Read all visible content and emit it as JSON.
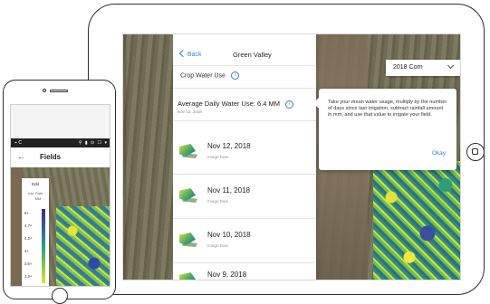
{
  "tablet": {
    "nav": {
      "back_label": "Back",
      "title": "Green Valley"
    },
    "section_title": "Crop Water Use",
    "average": {
      "label": "Average Daily Water Use: 6.4 MM",
      "date": "Nov 12, 2018"
    },
    "items": [
      {
        "date": "Nov 12, 2018",
        "subtitle": "Image Date"
      },
      {
        "date": "Nov 11, 2018",
        "subtitle": "Image Date"
      },
      {
        "date": "Nov 10, 2018",
        "subtitle": "Image Date"
      },
      {
        "date": "Nov 9, 2018",
        "subtitle": ""
      }
    ],
    "crop_select": {
      "value": "2018 Corn"
    },
    "tooltip": {
      "text": "Take your mean water usage, multiply by the number of days since last irrigation, subtract rainfall amount in mm, and use that value to irrigate your field.",
      "okay_label": "Okay"
    },
    "info_icon_glyph": "i"
  },
  "phone": {
    "status": {
      "left": "⌁ C",
      "right": "⚲ ▮ ⊙ ☐ ▾"
    },
    "back_glyph": "←",
    "title": "Fields",
    "legend": {
      "edit_label": "Edit",
      "unit_line1": "Use Rate",
      "unit_line2": "MM",
      "ticks": [
        "5+",
        "4.7+",
        "4.3+",
        "4+",
        "3.6+",
        "3.3+"
      ]
    }
  },
  "colors": {
    "accent_blue": "#3b7de0",
    "device_outline": "#2f2f2f"
  }
}
